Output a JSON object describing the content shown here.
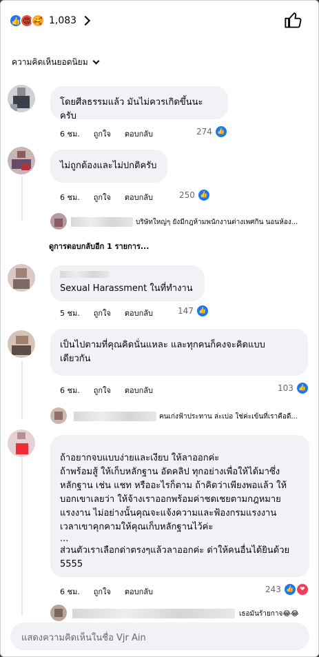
{
  "reactions": {
    "count": "1,083",
    "icons": [
      "like-icon",
      "angry-icon",
      "care-icon"
    ]
  },
  "sort_label": "ความคิดเห็นยอดนิยม",
  "comments": [
    {
      "text_lines": [
        "โดยศีลธรรมแล้ว มันไม่ควรเกิดขึ้นนะครับ"
      ],
      "time": "6 ชม.",
      "like": "ถูกใจ",
      "reply": "ตอบกลับ",
      "likes": "274"
    },
    {
      "text_lines": [
        "ไม่ถูกต้องและไม่ปกติครับ"
      ],
      "time": "6 ชม.",
      "like": "ถูกใจ",
      "reply": "ตอบกลับ",
      "likes": "250"
    },
    {
      "text_lines": [
        "Sexual Harassment ในที่ทำงาน"
      ],
      "time": "5 ชม.",
      "like": "ถูกใจ",
      "reply": "ตอบกลับ",
      "likes": "147"
    },
    {
      "text_lines": [
        "เป็นไปตามที่คุณคิดนั่นแหละ และทุกคนก็คงจะคิดแบบ",
        "เดียวกัน"
      ],
      "time": "6 ชม.",
      "like": "ถูกใจ",
      "reply": "ตอบกลับ",
      "likes": "103"
    },
    {
      "text_lines": [
        "ถ้าอยากจบแบบง่ายและเงียบ ให้ลาออกค่ะ",
        "ถ้าพร้อมสู้ ให้เก็บหลักฐาน อัดคลิป ทุกอย่างเพื่อให้ได้มาซึ่ง",
        "หลักฐาน เช่น แชท หรืออะไรก็ตาม ถ้าคิดว่าเพียงพอแล้ว ให้",
        "บอกเขาเลยว่า ให้จ้างเราออกพร้อมค่าชดเชยตามกฎหมาย",
        "แรงงาน ไม่อย่างนั้นคุณจะแจ้งความและฟ้องกรมแรงงาน",
        "เวลาเขาคุกคามให้คุณเก็บหลักฐานไว้ค่ะ",
        "...",
        "ส่วนตัวเราเลือกด่าตรงๆแล้วลาออกค่ะ ด่าให้คนอื่นได้ยินด้วย",
        "5555"
      ],
      "time": "6 ชม.",
      "like": "ถูกใจ",
      "reply": "ตอบกลับ",
      "likes": "243"
    }
  ],
  "replies": [
    "บริษัทใหญ่ๆ ยังมีกฎห้ามพนักงานต่างเพศกิน นอนห้อง...",
    "คนเก่งฟ้าประทาน ล่ะเบ่อ ใช่ค่ะเข้นที่เราคือดี...",
    "เธอมันร้ายกาจ😂😂"
  ],
  "more_replies": "ดูการตอบกลับอีก 1 รายการ...",
  "composer_placeholder": "แสดงความคิดเห็นในชื่อ Vjr Ain",
  "colors": {
    "like_blue": "#1877f2",
    "bubble_bg": "#f0f2f5",
    "love_red": "#f33e58"
  }
}
